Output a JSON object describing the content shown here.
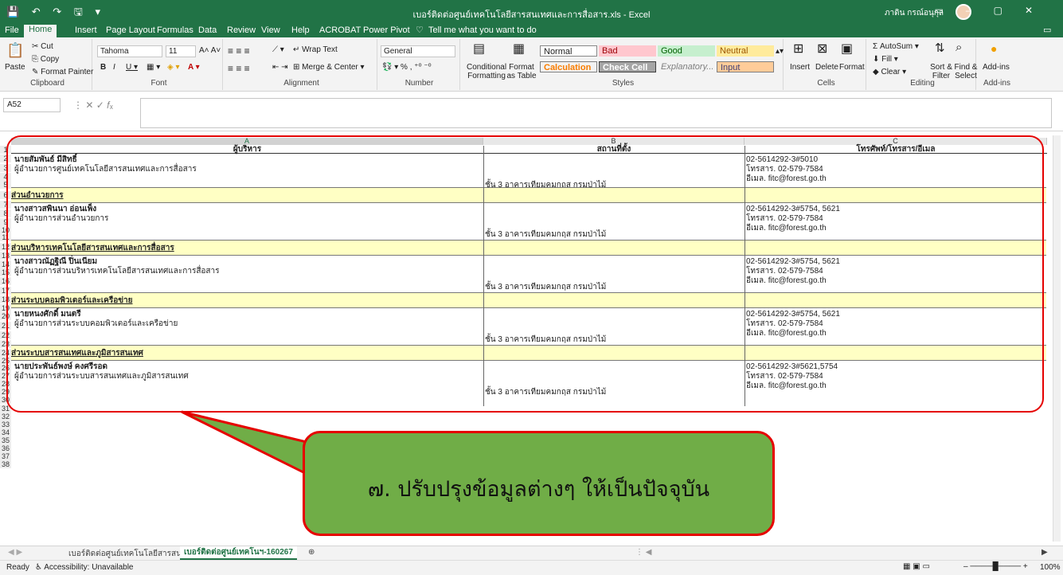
{
  "window": {
    "title": "เบอร์ติดต่อศูนย์เทคโนโลยีสารสนเทศและการสื่อสาร.xls - Excel",
    "user": "ภาดิน กรณ์อนุกุล",
    "qat": "💾 ↶ ↷ 🖫 ▾"
  },
  "ribbon_tabs": [
    "File",
    "Home",
    "Insert",
    "Page Layout",
    "Formulas",
    "Data",
    "Review",
    "View",
    "Help",
    "ACROBAT",
    "Power Pivot",
    "Tell me what you want to do"
  ],
  "ribbon": {
    "clipboard": {
      "paste": "Paste",
      "cut": "Cut",
      "copy": "Copy",
      "format_painter": "Format Painter",
      "label": "Clipboard"
    },
    "font": {
      "name": "Tahoma",
      "size": "11",
      "label": "Font"
    },
    "alignment": {
      "wrap": "Wrap Text",
      "merge": "Merge & Center",
      "label": "Alignment"
    },
    "number": {
      "format": "General",
      "label": "Number"
    },
    "styles": {
      "cond": "Conditional Formatting",
      "table": "Format as Table",
      "normal": "Normal",
      "bad": "Bad",
      "good": "Good",
      "neutral": "Neutral",
      "calculation": "Calculation",
      "check": "Check Cell",
      "explanatory": "Explanatory...",
      "input": "Input",
      "label": "Styles"
    },
    "cells": {
      "insert": "Insert",
      "delete": "Delete",
      "format": "Format",
      "label": "Cells"
    },
    "editing": {
      "autosum": "AutoSum",
      "fill": "Fill",
      "clear": "Clear",
      "sort": "Sort & Filter",
      "find": "Find & Select",
      "label": "Editing"
    },
    "addins": {
      "button": "Add-ins",
      "label": "Add-ins"
    }
  },
  "namebox": "A52",
  "columns": [
    "A",
    "B",
    "C"
  ],
  "headers": {
    "a": "ผู้บริหาร",
    "b": "สถานที่ตั้ง",
    "c": "โทรศัพท์/โทรสาร/อีเมล"
  },
  "director": {
    "name": "นายสัมพันธ์ มีสิทธิ์",
    "title": "ผู้อำนวยการศูนย์เทคโนโลยีสารสนเทศและการสื่อสาร",
    "loc": "ชั้น 3 อาคารเทียมคมกฤส กรมป่าไม้",
    "phone": "02-5614292-3#5010",
    "fax": "โทรสาร. 02-579-7584",
    "email": "อีเมล. fitc@forest.go.th"
  },
  "sections": [
    {
      "heading": "ส่วนอำนวยการ",
      "name": "นางสาวสพินนา อ่อนเพ็ง",
      "title": "ผู้อำนวยการส่วนอำนวยการ",
      "loc": "ชั้น 3 อาคารเทียมคมกฤส กรมป่าไม้",
      "phone": "02-5614292-3#5754, 5621",
      "fax": "โทรสาร. 02-579-7584",
      "email": "อีเมล. fitc@forest.go.th"
    },
    {
      "heading": "ส่วนบริหารเทคโนโลยีสารสนเทศและการสื่อสาร",
      "name": "นางสาวณัฏฐิณี ปิ่นเนียม",
      "title": "ผู้อำนวยการส่วนบริหารเทคโนโลยีสารสนเทศและการสื่อสาร",
      "loc": "ชั้น 3 อาคารเทียมคมกฤส กรมป่าไม้",
      "phone": "02-5614292-3#5754, 5621",
      "fax": "โทรสาร. 02-579-7584",
      "email": "อีเมล. fitc@forest.go.th"
    },
    {
      "heading": "ส่วนระบบคอมพิวเตอร์และเครือข่าย",
      "name": "นายหนงศักดิ์ มนตรี",
      "title": "ผู้อำนวยการส่วนระบบคอมพิวเตอร์และเครือข่าย",
      "loc": "ชั้น 3 อาคารเทียมคมกฤส กรมป่าไม้",
      "phone": "02-5614292-3#5754, 5621",
      "fax": "โทรสาร. 02-579-7584",
      "email": "อีเมล. fitc@forest.go.th"
    },
    {
      "heading": "ส่วนระบบสารสนเทศและภูมิสารสนเทศ",
      "name": "นายประพันธ์พงษ์ คงศรีรอด",
      "title": "ผู้อำนวยการส่วนระบบสารสนเทศและภูมิสารสนเทศ",
      "loc": "ชั้น 3 อาคารเทียมคมกฤส กรมป่าไม้",
      "phone": "02-5614292-3#5621,5754",
      "fax": "โทรสาร. 02-579-7584",
      "email": "อีเมล. fitc@forest.go.th"
    }
  ],
  "sheet_tabs": [
    "เบอร์ติดต่อศูนย์เทคโนโลยีสารสนเ",
    "เบอร์ติดต่อศูนย์เทคโนฯ-160267"
  ],
  "status": {
    "ready": "Ready",
    "accessibility": "Accessibility: Unavailable",
    "zoom": "100%"
  },
  "callout": "๗. ปรับปรุงข้อมูลต่างๆ ให้เป็นปัจจุบัน",
  "colors": {
    "excel_green": "#217346",
    "highlight": "#ffffc4",
    "callout_fill": "#70ad47",
    "callout_border": "#e50000"
  }
}
